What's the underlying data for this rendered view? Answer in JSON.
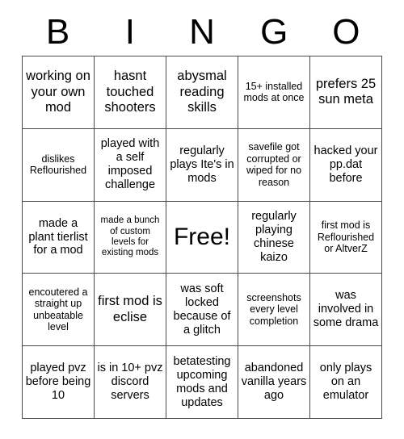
{
  "card": {
    "title": "BINGO",
    "header_letters": [
      "B",
      "I",
      "N",
      "G",
      "O"
    ],
    "grid_size": 5,
    "free_space_index": 12,
    "colors": {
      "background": "#ffffff",
      "text": "#000000",
      "grid_line": "#4a4a4a"
    },
    "cells": [
      {
        "text": "working on your own mod",
        "size": "lg",
        "free": false
      },
      {
        "text": "hasnt touched shooters",
        "size": "lg",
        "free": false
      },
      {
        "text": "abysmal reading skills",
        "size": "lg",
        "free": false
      },
      {
        "text": "15+ installed mods at once",
        "size": "sm",
        "free": false
      },
      {
        "text": "prefers 25 sun meta",
        "size": "lg",
        "free": false
      },
      {
        "text": "dislikes Reflourished",
        "size": "sm",
        "free": false
      },
      {
        "text": "played with a self imposed challenge",
        "size": "md",
        "free": false
      },
      {
        "text": "regularly plays Ite's in mods",
        "size": "md",
        "free": false
      },
      {
        "text": "savefile got corrupted or wiped for no reason",
        "size": "sm",
        "free": false
      },
      {
        "text": "hacked your pp.dat before",
        "size": "md",
        "free": false
      },
      {
        "text": "made a plant tierlist for a mod",
        "size": "md",
        "free": false
      },
      {
        "text": "made a bunch of custom levels for existing mods",
        "size": "xs",
        "free": false
      },
      {
        "text": "Free!",
        "size": "xl",
        "free": true
      },
      {
        "text": "regularly playing chinese kaizo",
        "size": "md",
        "free": false
      },
      {
        "text": "first mod is Reflourished or AltverZ",
        "size": "sm",
        "free": false
      },
      {
        "text": "encoutered a straight up unbeatable level",
        "size": "sm",
        "free": false
      },
      {
        "text": "first mod is eclise",
        "size": "lg",
        "free": false
      },
      {
        "text": "was soft locked because of a glitch",
        "size": "md",
        "free": false
      },
      {
        "text": "screenshots every level completion",
        "size": "sm",
        "free": false
      },
      {
        "text": "was involved in some drama",
        "size": "md",
        "free": false
      },
      {
        "text": "played pvz before being 10",
        "size": "md",
        "free": false
      },
      {
        "text": "is in 10+ pvz discord servers",
        "size": "md",
        "free": false
      },
      {
        "text": "betatesting upcoming mods and updates",
        "size": "md",
        "free": false
      },
      {
        "text": "abandoned vanilla years ago",
        "size": "md",
        "free": false
      },
      {
        "text": "only plays on an emulator",
        "size": "md",
        "free": false
      }
    ]
  }
}
